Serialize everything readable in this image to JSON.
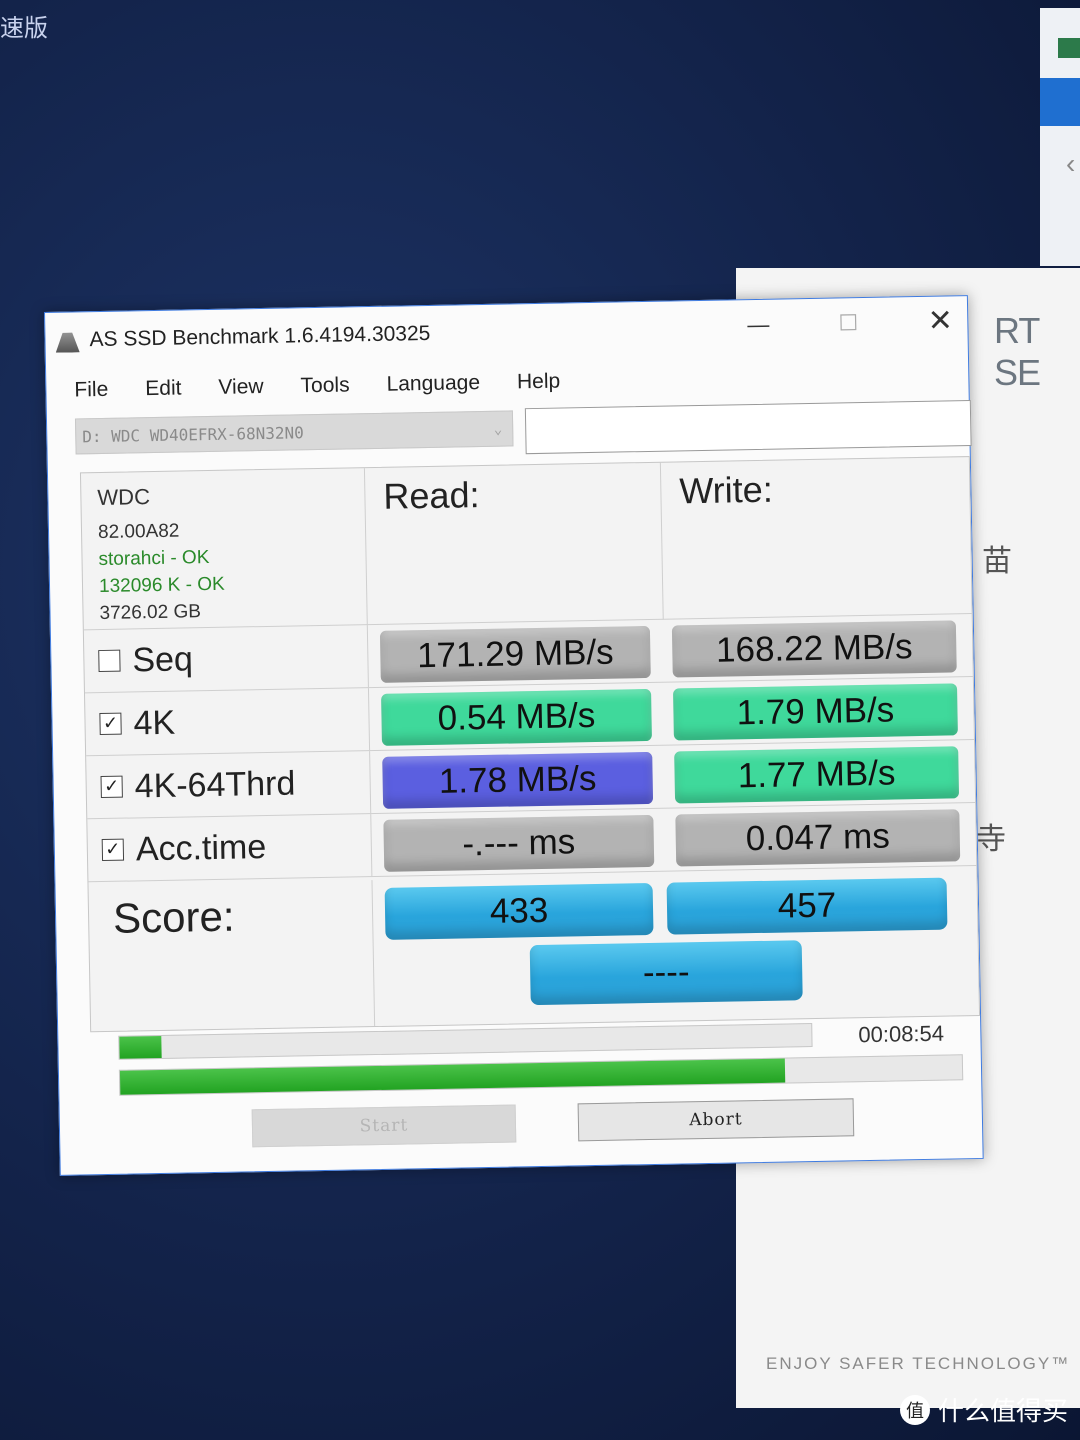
{
  "background": {
    "corner_text": "速版",
    "right_window_title": "RT SE",
    "right_window_char1": "苗",
    "right_window_char2": "寺",
    "right_window_footer": "ENJOY SAFER TECHNOLOGY™",
    "watermark_text": "什么值得买",
    "watermark_icon_char": "值"
  },
  "window": {
    "title": "AS SSD Benchmark 1.6.4194.30325",
    "controls": {
      "minimize": "—",
      "maximize": "☐",
      "close": "✕"
    }
  },
  "menu": [
    "File",
    "Edit",
    "View",
    "Tools",
    "Language",
    "Help"
  ],
  "drive_select": {
    "value": "D: WDC WD40EFRX-68N32N0"
  },
  "info": {
    "vendor": "WDC",
    "firmware": "82.00A82",
    "driver": "storahci - OK",
    "alignment": "132096 K - OK",
    "capacity": "3726.02 GB"
  },
  "headers": {
    "read": "Read:",
    "write": "Write:"
  },
  "rows": [
    {
      "label": "Seq",
      "checked": false,
      "read": "171.29 MB/s",
      "write": "168.22 MB/s",
      "read_color": "#b3b3b3",
      "write_color": "#b3b3b3"
    },
    {
      "label": "4K",
      "checked": true,
      "read": "0.54 MB/s",
      "write": "1.79 MB/s",
      "read_color": "#3fd99b",
      "write_color": "#3fd99b"
    },
    {
      "label": "4K-64Thrd",
      "checked": true,
      "read": "1.78 MB/s",
      "write": "1.77 MB/s",
      "read_color": "#5b5fe0",
      "write_color": "#3fd99b"
    },
    {
      "label": "Acc.time",
      "checked": true,
      "read": "-.--- ms",
      "write": "0.047 ms",
      "read_color": "#b3b3b3",
      "write_color": "#b3b3b3"
    }
  ],
  "score": {
    "label": "Score:",
    "read": "433",
    "write": "457",
    "total": "----"
  },
  "progress": {
    "small_fraction": 0.06,
    "big_fraction": 0.79,
    "time": "00:08:54"
  },
  "buttons": {
    "start": "Start",
    "abort": "Abort"
  },
  "checkbox_glyph": "✓"
}
